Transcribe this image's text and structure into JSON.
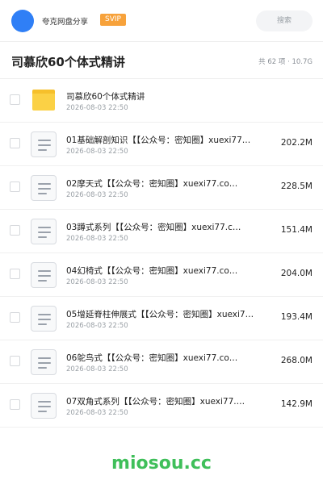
{
  "header": {
    "brand": "夸克网盘分享",
    "badge": "SVIP",
    "search_placeholder": "搜索"
  },
  "folder": {
    "title": "司慕欣60个体式精讲",
    "summary": "共 62 项 · 10.7G"
  },
  "items": [
    {
      "type": "folder",
      "name": "司慕欣60个体式精讲",
      "date": "2026-08-03 22:50",
      "size": ""
    },
    {
      "type": "file",
      "name": "01基础解剖知识【【公众号：密知圈】xuexi77…",
      "date": "2026-08-03 22:50",
      "size": "202.2M"
    },
    {
      "type": "file",
      "name": "02摩天式【【公众号：密知圈】xuexi77.co…",
      "date": "2026-08-03 22:50",
      "size": "228.5M"
    },
    {
      "type": "file",
      "name": "03蹲式系列【【公众号：密知圈】xuexi77.c…",
      "date": "2026-08-03 22:50",
      "size": "151.4M"
    },
    {
      "type": "file",
      "name": "04幻椅式【【公众号：密知圈】xuexi77.co…",
      "date": "2026-08-03 22:50",
      "size": "204.0M"
    },
    {
      "type": "file",
      "name": "05增延脊柱伸展式【【公众号：密知圈】xuexi7…",
      "date": "2026-08-03 22:50",
      "size": "193.4M"
    },
    {
      "type": "file",
      "name": "06鸵鸟式【【公众号：密知圈】xuexi77.co…",
      "date": "2026-08-03 22:50",
      "size": "268.0M"
    },
    {
      "type": "file",
      "name": "07双角式系列【【公众号：密知圈】xuexi77.…",
      "date": "2026-08-03 22:50",
      "size": "142.9M"
    }
  ],
  "watermark": "miosou.cc",
  "colors": {
    "accent": "#2f7ff6",
    "svip": "#f7a23b",
    "folder": "#fbd145",
    "watermark": "#3fbf5a"
  }
}
